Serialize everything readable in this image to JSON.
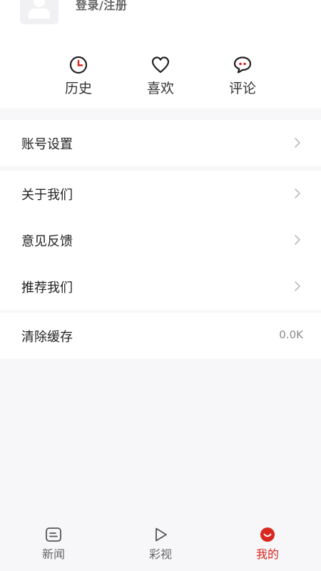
{
  "profile": {
    "login_label": "登录/注册"
  },
  "quick": [
    {
      "label": "历史",
      "icon": "clock-icon"
    },
    {
      "label": "喜欢",
      "icon": "heart-icon"
    },
    {
      "label": "评论",
      "icon": "comment-icon"
    }
  ],
  "settings": {
    "account": "账号设置",
    "about": "关于我们",
    "feedback": "意见反馈",
    "recommend": "推荐我们",
    "clear_cache": "清除缓存",
    "cache_size": "0.0K"
  },
  "tabs": [
    {
      "label": "新闻",
      "icon": "news-icon"
    },
    {
      "label": "彩视",
      "icon": "play-icon"
    },
    {
      "label": "我的",
      "icon": "mine-icon",
      "active": true
    }
  ],
  "colors": {
    "accent": "#d8281f",
    "background": "#f7f6f8"
  }
}
